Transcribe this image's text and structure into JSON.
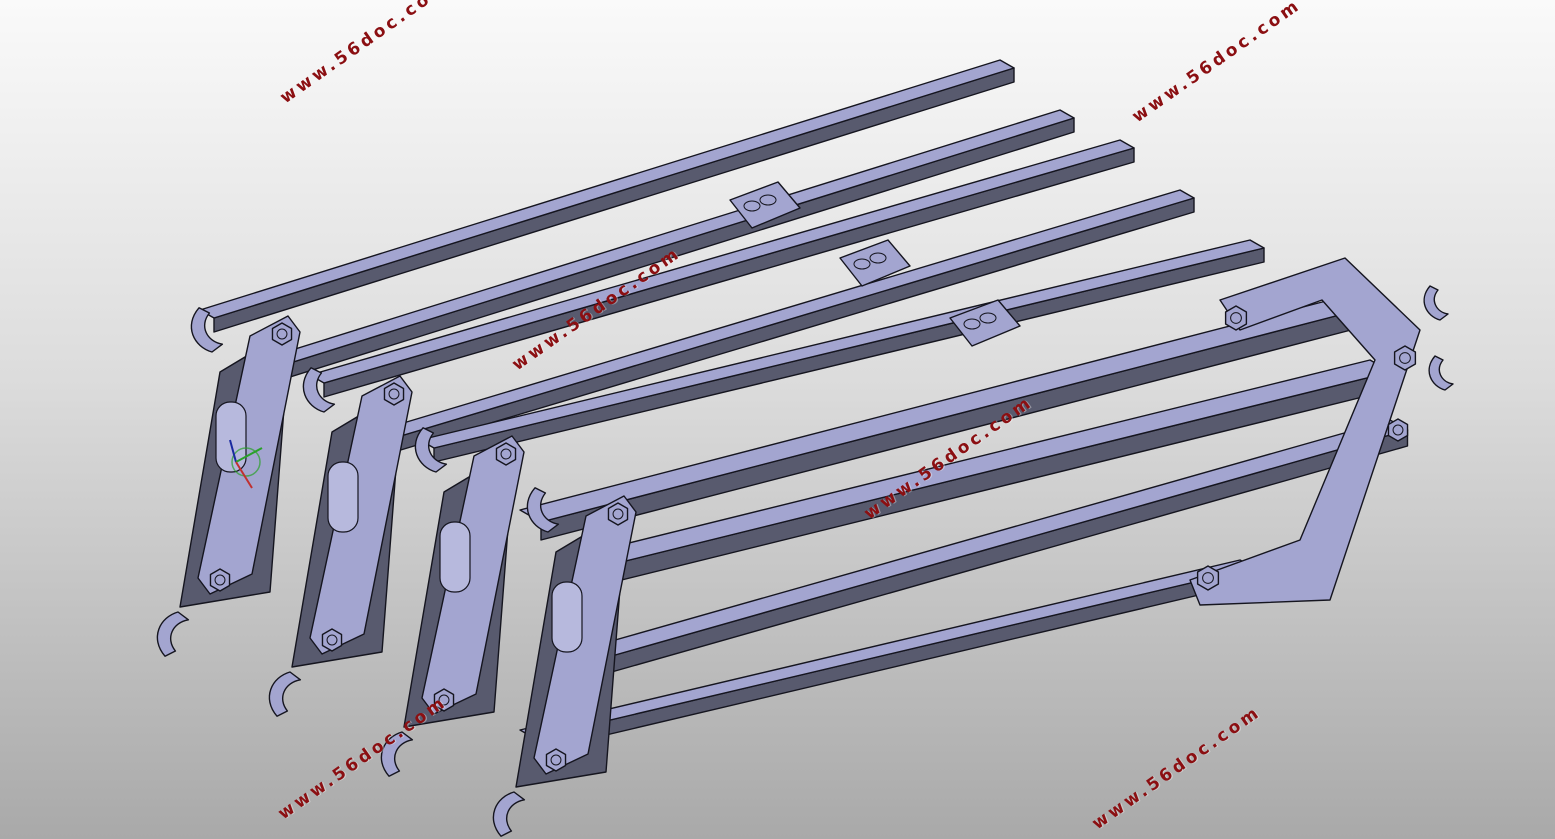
{
  "viewport": {
    "background_top": "#fafafa",
    "background_bottom": "#a9a9a9"
  },
  "model": {
    "face_color": "#a3a5d0",
    "shadow_color": "#585a6e",
    "edge_color": "#15151f",
    "module_count": 4
  },
  "watermarks": [
    {
      "text": "www.56doc.com"
    },
    {
      "text": "www.56doc.com"
    },
    {
      "text": "www.56doc.com"
    },
    {
      "text": "www.56doc.com"
    },
    {
      "text": "www.56doc.com"
    },
    {
      "text": "www.56doc.com"
    }
  ],
  "triad": {
    "icon": "axis-triad-icon"
  }
}
